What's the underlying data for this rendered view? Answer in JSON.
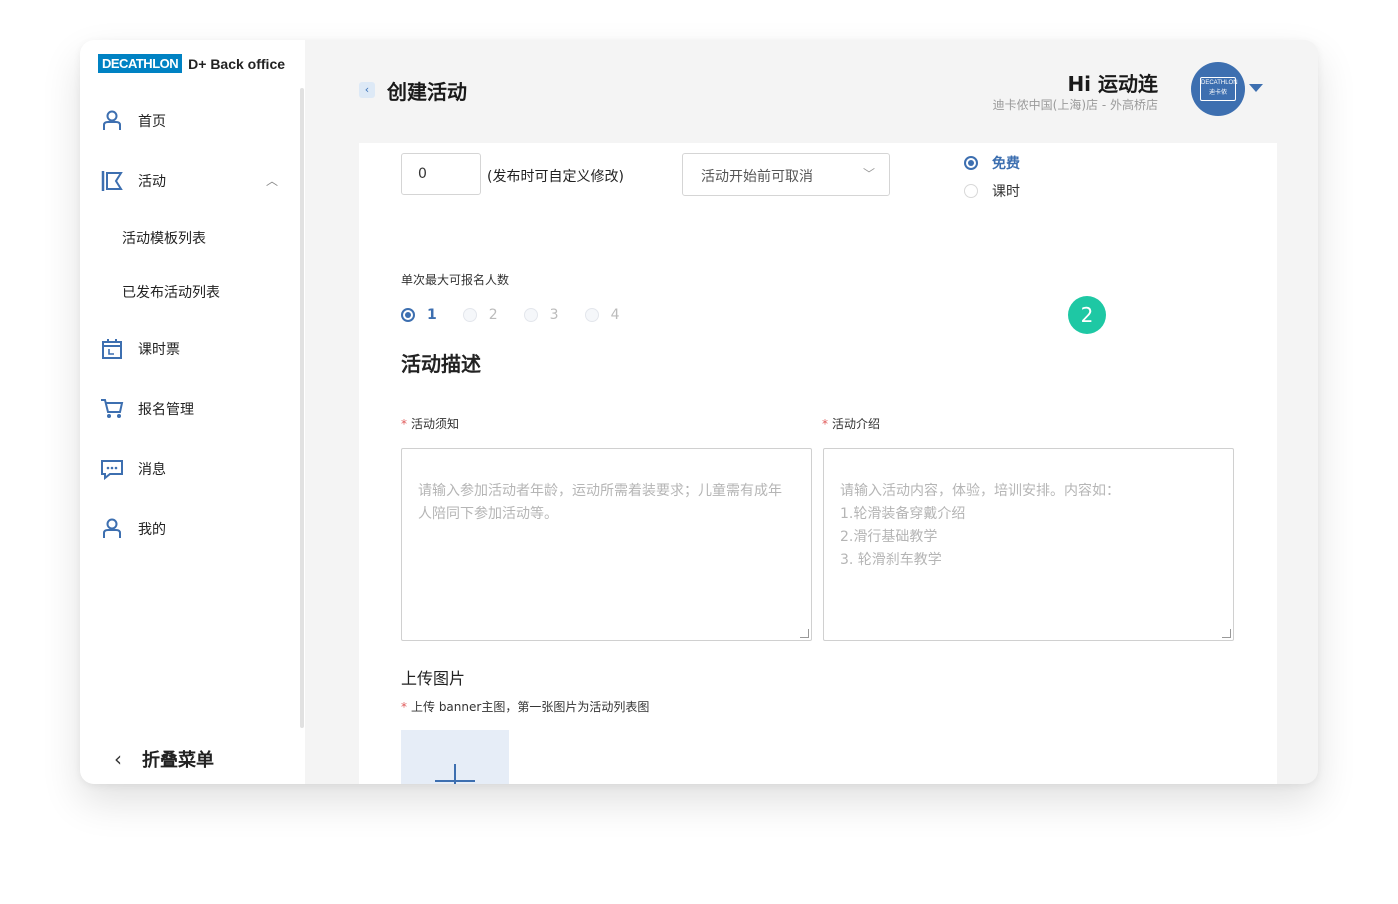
{
  "brand": {
    "logo_text": "DECATHLON",
    "product": "D+ Back office"
  },
  "sidebar": {
    "items": [
      {
        "label": "首页",
        "icon": "user-icon"
      },
      {
        "label": "活动",
        "icon": "flag-icon"
      },
      {
        "label": "课时票",
        "icon": "calendar-icon"
      },
      {
        "label": "报名管理",
        "icon": "cart-icon"
      },
      {
        "label": "消息",
        "icon": "message-icon"
      },
      {
        "label": "我的",
        "icon": "user-icon"
      }
    ],
    "sub_items": [
      "活动模板列表",
      "已发布活动列表"
    ],
    "collapse_label": "折叠菜单",
    "collapse_icon": "‹"
  },
  "header": {
    "back_icon": "‹",
    "title": "创建活动",
    "greeting": "Hi 运动连",
    "store": "迪卡侬中国(上海)店 - 外高桥店",
    "avatar_text": "DECATHLON 迪卡侬"
  },
  "form": {
    "cancel_days_value": "0",
    "cancel_note": "(发布时可自定义修改)",
    "cancel_select": "活动开始前可取消",
    "price_options": [
      {
        "label": "免费",
        "selected": true
      },
      {
        "label": "课时",
        "selected": false
      }
    ],
    "max_people_label": "单次最大可报名人数",
    "max_people_options": [
      "1",
      "2",
      "3",
      "4"
    ],
    "max_people_selected": "1",
    "step_badge": "2",
    "description_title": "活动描述",
    "notice_label": "活动须知",
    "notice_placeholder": "请输入参加活动者年龄，运动所需着装要求；儿童需有成年人陪同下参加活动等。",
    "intro_label": "活动介绍",
    "intro_placeholder": "请输入活动内容，体验，培训安排。内容如：\n1.轮滑装备穿戴介绍\n2.滑行基础教学\n3. 轮滑刹车教学",
    "required_mark": "*",
    "upload_title": "上传图片",
    "upload_hint": "上传 banner主图，第一张图片为活动列表图"
  },
  "colors": {
    "accent": "#3d6fb0",
    "badge": "#1ec8a4",
    "brand": "#0082c3",
    "required": "#e05a5a"
  }
}
